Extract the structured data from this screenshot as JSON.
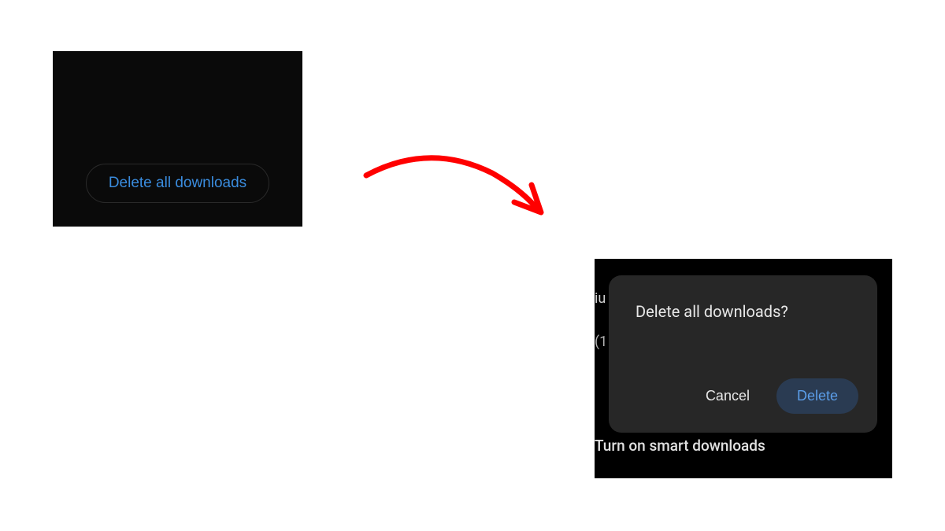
{
  "panel1": {
    "delete_all_label": "Delete all downloads"
  },
  "panel2": {
    "bg_text1": "iu",
    "bg_text2": "(1",
    "bg_text3": "Turn on smart downloads",
    "dialog": {
      "title": "Delete all downloads?",
      "cancel_label": "Cancel",
      "delete_label": "Delete"
    }
  }
}
